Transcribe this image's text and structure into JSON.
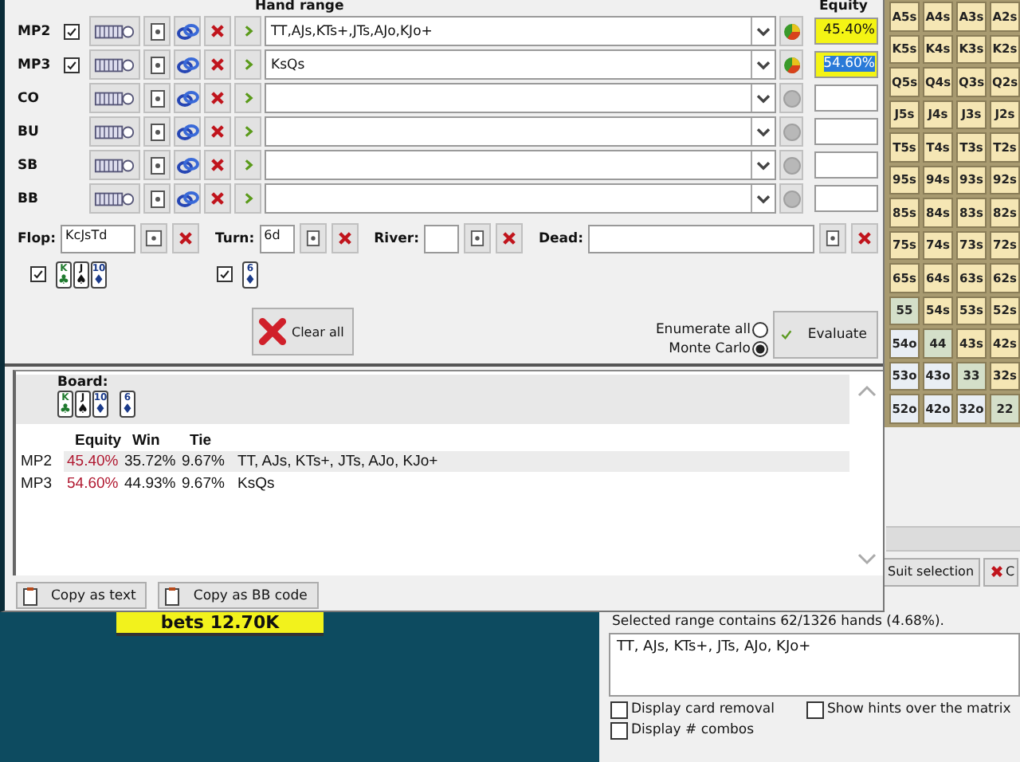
{
  "hand_range_header": "Hand range",
  "equity_header": "Equity",
  "players": [
    {
      "position": "MP2",
      "checked": true,
      "range": "TT,AJs,KTs+,JTs,AJo,KJo+",
      "active": true,
      "equity": "45.40%",
      "equity_selected": false
    },
    {
      "position": "MP3",
      "checked": true,
      "range": "KsQs",
      "active": true,
      "equity": "54.60%",
      "equity_selected": true
    },
    {
      "position": "CO",
      "active": false
    },
    {
      "position": "BU",
      "active": false
    },
    {
      "position": "SB",
      "active": false
    },
    {
      "position": "BB",
      "active": false
    }
  ],
  "board": {
    "flop_label": "Flop:",
    "flop": "KcJsTd",
    "turn_label": "Turn:",
    "turn": "6d",
    "river_label": "River:",
    "dead_label": "Dead:"
  },
  "flop_cards": {
    "checked": true,
    "cards": [
      {
        "rank": "K",
        "suit": "♣",
        "color": "#1f7a2e"
      },
      {
        "rank": "J",
        "suit": "♠",
        "color": "#111111"
      },
      {
        "rank": "10",
        "suit": "♦",
        "color": "#1a3a8a"
      }
    ]
  },
  "turn_cards": {
    "checked": true,
    "cards": [
      {
        "rank": "6",
        "suit": "♦",
        "color": "#1a3a8a"
      }
    ]
  },
  "clear_button": "Clear all",
  "modes": [
    {
      "label": "Enumerate all",
      "selected": false
    },
    {
      "label": "Monte Carlo",
      "selected": true
    }
  ],
  "evaluate_button": "Evaluate",
  "results": {
    "board_label": "Board:",
    "flop_cards": [
      {
        "rank": "K",
        "suit": "♣",
        "color": "#1f7a2e"
      },
      {
        "rank": "J",
        "suit": "♠",
        "color": "#111111"
      },
      {
        "rank": "10",
        "suit": "♦",
        "color": "#1a3a8a"
      }
    ],
    "turn_cards": [
      {
        "rank": "6",
        "suit": "♦",
        "color": "#1a3a8a"
      }
    ],
    "columns": [
      "Equity",
      "Win",
      "Tie"
    ],
    "rows": [
      {
        "player": "MP2",
        "equity": "45.40%",
        "win": "35.72%",
        "tie": "9.67%",
        "hand": "TT, AJs, KTs+, JTs, AJo, KJo+",
        "selected": true
      },
      {
        "player": "MP3",
        "equity": "54.60%",
        "win": "44.93%",
        "tie": "9.67%",
        "hand": "KsQs",
        "selected": false
      }
    ]
  },
  "copy_buttons": [
    "Copy as text",
    "Copy as BB code"
  ],
  "overlay_label": "bets 12.70K",
  "range_window": {
    "matrix": [
      [
        {
          "label": "A5s",
          "color": "#f5e6b4"
        },
        {
          "label": "A4s",
          "color": "#f5e6b4"
        },
        {
          "label": "A3s",
          "color": "#f5e6b4"
        },
        {
          "label": "A2s",
          "color": "#f5e6b4"
        }
      ],
      [
        {
          "label": "K5s",
          "color": "#f5e6b4"
        },
        {
          "label": "K4s",
          "color": "#f5e6b4"
        },
        {
          "label": "K3s",
          "color": "#f5e6b4"
        },
        {
          "label": "K2s",
          "color": "#f5e6b4"
        }
      ],
      [
        {
          "label": "Q5s",
          "color": "#f5e6b4"
        },
        {
          "label": "Q4s",
          "color": "#f5e6b4"
        },
        {
          "label": "Q3s",
          "color": "#f5e6b4"
        },
        {
          "label": "Q2s",
          "color": "#f5e6b4"
        }
      ],
      [
        {
          "label": "J5s",
          "color": "#f5e6b4"
        },
        {
          "label": "J4s",
          "color": "#f5e6b4"
        },
        {
          "label": "J3s",
          "color": "#f5e6b4"
        },
        {
          "label": "J2s",
          "color": "#f5e6b4"
        }
      ],
      [
        {
          "label": "T5s",
          "color": "#f5e6b4"
        },
        {
          "label": "T4s",
          "color": "#f5e6b4"
        },
        {
          "label": "T3s",
          "color": "#f5e6b4"
        },
        {
          "label": "T2s",
          "color": "#f5e6b4"
        }
      ],
      [
        {
          "label": "95s",
          "color": "#f5e6b4"
        },
        {
          "label": "94s",
          "color": "#f5e6b4"
        },
        {
          "label": "93s",
          "color": "#f5e6b4"
        },
        {
          "label": "92s",
          "color": "#f5e6b4"
        }
      ],
      [
        {
          "label": "85s",
          "color": "#f5e6b4"
        },
        {
          "label": "84s",
          "color": "#f5e6b4"
        },
        {
          "label": "83s",
          "color": "#f5e6b4"
        },
        {
          "label": "82s",
          "color": "#f5e6b4"
        }
      ],
      [
        {
          "label": "75s",
          "color": "#f5e6b4"
        },
        {
          "label": "74s",
          "color": "#f5e6b4"
        },
        {
          "label": "73s",
          "color": "#f5e6b4"
        },
        {
          "label": "72s",
          "color": "#f5e6b4"
        }
      ],
      [
        {
          "label": "65s",
          "color": "#f5e6b4"
        },
        {
          "label": "64s",
          "color": "#f5e6b4"
        },
        {
          "label": "63s",
          "color": "#f5e6b4"
        },
        {
          "label": "62s",
          "color": "#f5e6b4"
        }
      ],
      [
        {
          "label": "55",
          "color": "#d4dfc9"
        },
        {
          "label": "54s",
          "color": "#f5e6b4"
        },
        {
          "label": "53s",
          "color": "#f5e6b4"
        },
        {
          "label": "52s",
          "color": "#f5e6b4"
        }
      ],
      [
        {
          "label": "54o",
          "color": "#e9eef4"
        },
        {
          "label": "44",
          "color": "#d4dfc9"
        },
        {
          "label": "43s",
          "color": "#f5e6b4"
        },
        {
          "label": "42s",
          "color": "#f5e6b4"
        }
      ],
      [
        {
          "label": "53o",
          "color": "#e9eef4"
        },
        {
          "label": "43o",
          "color": "#e9eef4"
        },
        {
          "label": "33",
          "color": "#d4dfc9"
        },
        {
          "label": "32s",
          "color": "#f5e6b4"
        }
      ],
      [
        {
          "label": "52o",
          "color": "#e9eef4"
        },
        {
          "label": "42o",
          "color": "#e9eef4"
        },
        {
          "label": "32o",
          "color": "#e9eef4"
        },
        {
          "label": "22",
          "color": "#d4dfc9"
        }
      ]
    ],
    "suit_selection_button": "Suit selection",
    "clear_button": "C",
    "info": "Selected range contains 62/1326 hands (4.68%).",
    "range_text": "TT, AJs, KTs+, JTs, AJo, KJo+",
    "options": [
      {
        "label": "Display card removal",
        "checked": false
      },
      {
        "label": "Show hints over the matrix",
        "checked": false
      },
      {
        "label": "Display # combos",
        "checked": false
      }
    ]
  }
}
